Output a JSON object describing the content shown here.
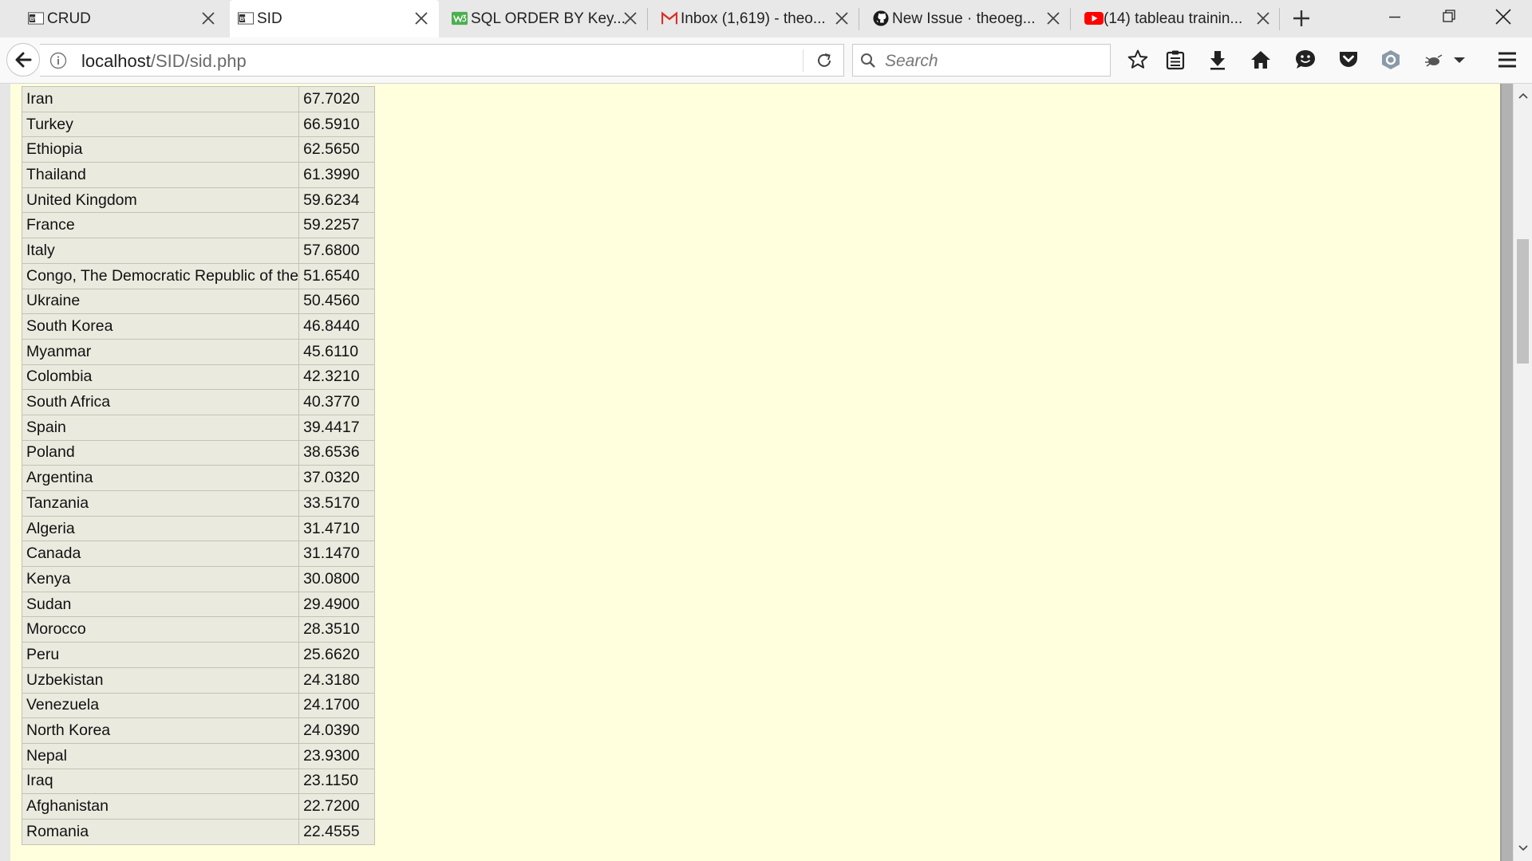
{
  "browser": {
    "tabs": [
      {
        "title": "CRUD",
        "icon": "bw-logo-icon",
        "active": false
      },
      {
        "title": "SID",
        "icon": "bw-logo-icon",
        "active": true
      },
      {
        "title": "SQL ORDER BY Key...",
        "icon": "w3schools-icon",
        "active": false
      },
      {
        "title": "Inbox (1,619) - theo...",
        "icon": "gmail-icon",
        "active": false
      },
      {
        "title": "New Issue · theoeg...",
        "icon": "github-icon",
        "active": false
      },
      {
        "title": "(14) tableau trainin...",
        "icon": "youtube-icon",
        "active": false
      }
    ],
    "bw_icon_text": "BW",
    "url_host": "localhost",
    "url_path": "/SID/sid.php",
    "search_placeholder": "Search",
    "colors": {
      "content_bg": "#ffffdd",
      "table_bg": "#eaeadf",
      "gmail_red": "#d93025",
      "youtube_red": "#ff0000",
      "w3_green": "#4caf50"
    }
  },
  "table": {
    "rows": [
      {
        "country": "Iran",
        "value": "67.7020"
      },
      {
        "country": "Turkey",
        "value": "66.5910"
      },
      {
        "country": "Ethiopia",
        "value": "62.5650"
      },
      {
        "country": "Thailand",
        "value": "61.3990"
      },
      {
        "country": "United Kingdom",
        "value": "59.6234"
      },
      {
        "country": "France",
        "value": "59.2257"
      },
      {
        "country": "Italy",
        "value": "57.6800"
      },
      {
        "country": "Congo, The Democratic Republic of the",
        "value": "51.6540"
      },
      {
        "country": "Ukraine",
        "value": "50.4560"
      },
      {
        "country": "South Korea",
        "value": "46.8440"
      },
      {
        "country": "Myanmar",
        "value": "45.6110"
      },
      {
        "country": "Colombia",
        "value": "42.3210"
      },
      {
        "country": "South Africa",
        "value": "40.3770"
      },
      {
        "country": "Spain",
        "value": "39.4417"
      },
      {
        "country": "Poland",
        "value": "38.6536"
      },
      {
        "country": "Argentina",
        "value": "37.0320"
      },
      {
        "country": "Tanzania",
        "value": "33.5170"
      },
      {
        "country": "Algeria",
        "value": "31.4710"
      },
      {
        "country": "Canada",
        "value": "31.1470"
      },
      {
        "country": "Kenya",
        "value": "30.0800"
      },
      {
        "country": "Sudan",
        "value": "29.4900"
      },
      {
        "country": "Morocco",
        "value": "28.3510"
      },
      {
        "country": "Peru",
        "value": "25.6620"
      },
      {
        "country": "Uzbekistan",
        "value": "24.3180"
      },
      {
        "country": "Venezuela",
        "value": "24.1700"
      },
      {
        "country": "North Korea",
        "value": "24.0390"
      },
      {
        "country": "Nepal",
        "value": "23.9300"
      },
      {
        "country": "Iraq",
        "value": "23.1150"
      },
      {
        "country": "Afghanistan",
        "value": "22.7200"
      },
      {
        "country": "Romania",
        "value": "22.4555"
      }
    ]
  }
}
